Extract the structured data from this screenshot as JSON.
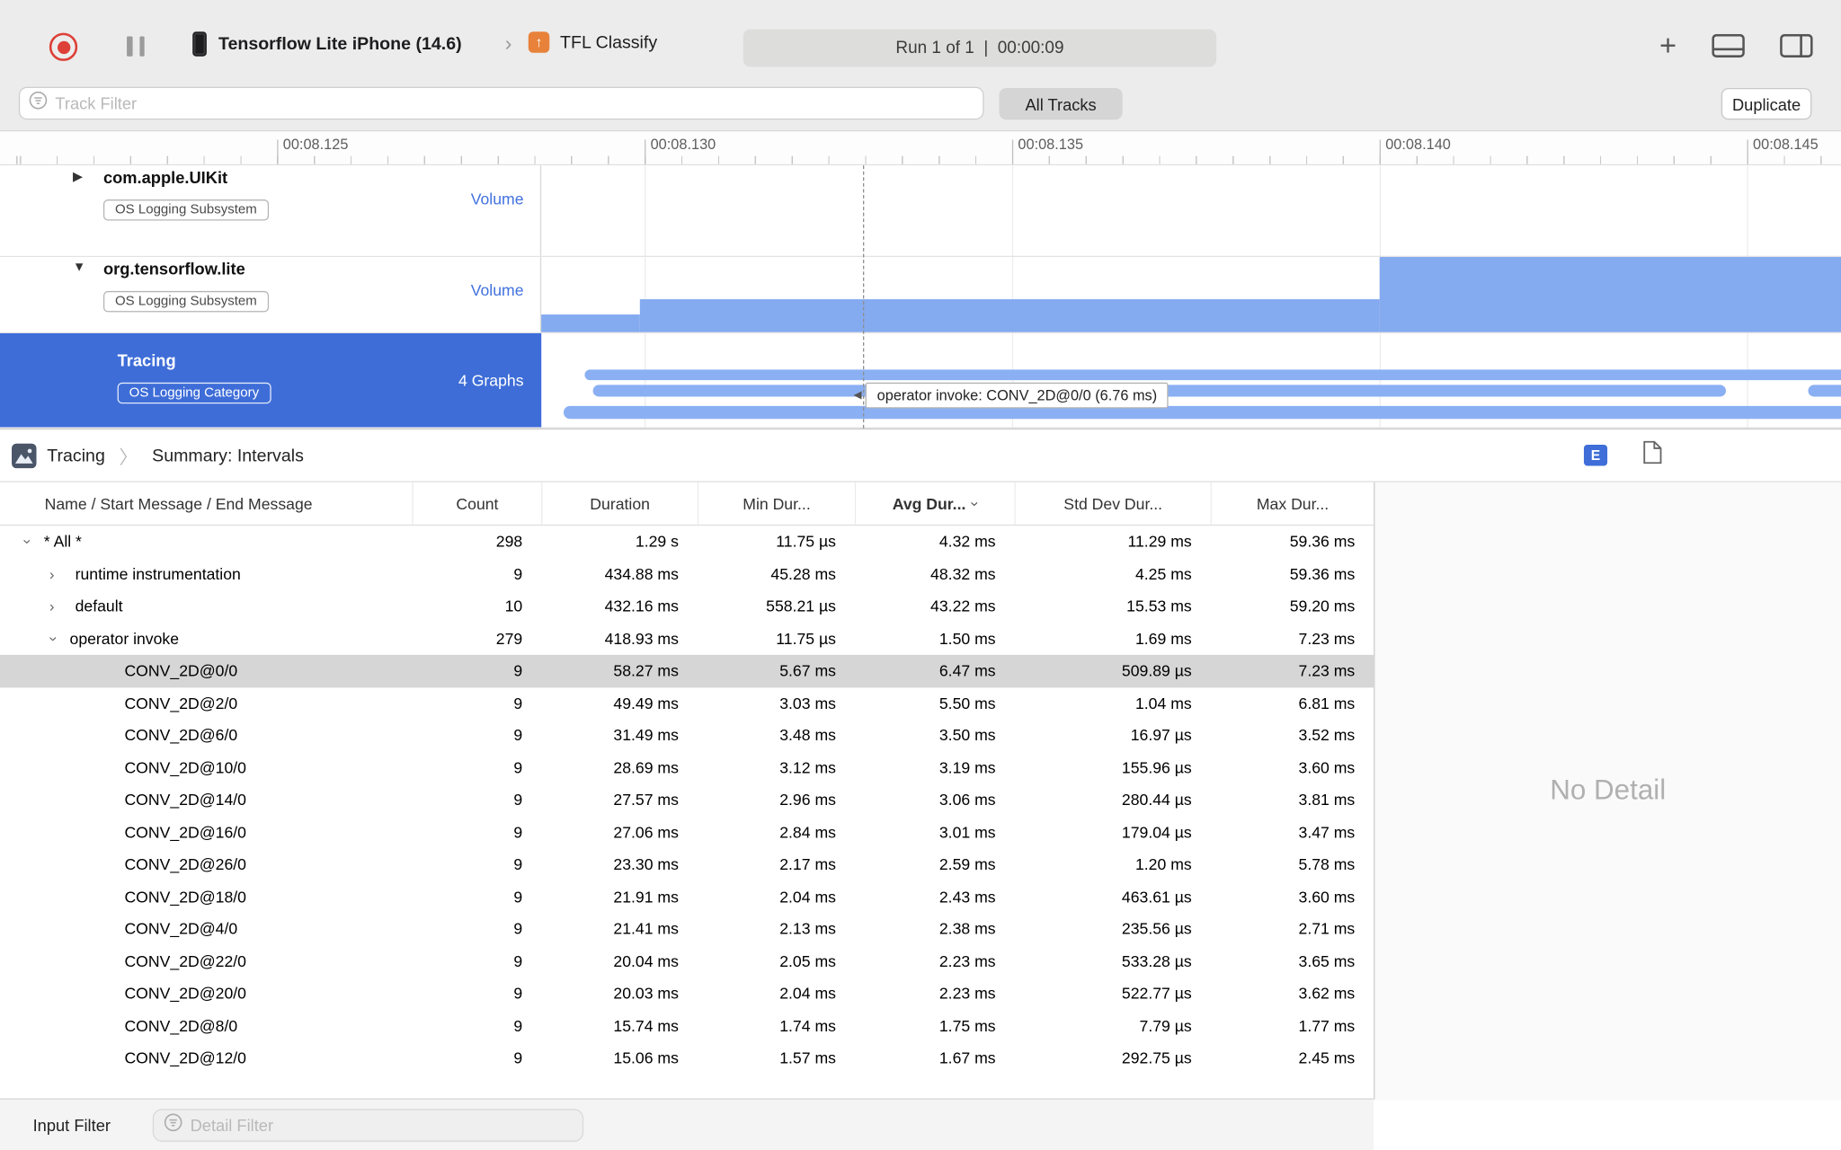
{
  "toolbar": {
    "device_name": "Tensorflow Lite iPhone (14.6)",
    "target_name": "TFL Classify",
    "run_status": "Run 1 of 1  |  00:00:09"
  },
  "filter_bar": {
    "track_filter_placeholder": "Track Filter",
    "all_tracks": "All Tracks",
    "duplicate": "Duplicate"
  },
  "ruler": {
    "labels": [
      "00:08.125",
      "00:08.130",
      "00:08.135",
      "00:08.140",
      "00:08.145"
    ]
  },
  "tracks": [
    {
      "name": "com.apple.UIKit",
      "badge": "OS Logging Subsystem",
      "meta": "Volume",
      "disclosure": "collapsed"
    },
    {
      "name": "org.tensorflow.lite",
      "badge": "OS Logging Subsystem",
      "meta": "Volume",
      "disclosure": "expanded"
    },
    {
      "name": "Tracing",
      "badge": "OS Logging Category",
      "meta": "4 Graphs",
      "selected": true
    }
  ],
  "timeline": {
    "tooltip": "operator invoke: CONV_2D@0/0 (6.76 ms)"
  },
  "breadcrumb": {
    "root": "Tracing",
    "page": "Summary: Intervals"
  },
  "detail_panel": {
    "empty_text": "No Detail",
    "jump_button": "E"
  },
  "bottom_bar": {
    "label": "Input Filter",
    "detail_filter_placeholder": "Detail Filter"
  },
  "table": {
    "columns": [
      "Name / Start Message / End Message",
      "Count",
      "Duration",
      "Min Dur...",
      "Avg Dur...",
      "Std Dev Dur...",
      "Max Dur..."
    ],
    "sorted_column": "Avg Dur...",
    "rows": [
      {
        "level": 0,
        "disclosure": "open",
        "name": "* All *",
        "count": "298",
        "duration": "1.29 s",
        "min": "11.75 µs",
        "avg": "4.32 ms",
        "std": "11.29 ms",
        "max": "59.36 ms",
        "selected": false
      },
      {
        "level": 1,
        "disclosure": "closed",
        "name": "runtime instrumentation",
        "count": "9",
        "duration": "434.88 ms",
        "min": "45.28 ms",
        "avg": "48.32 ms",
        "std": "4.25 ms",
        "max": "59.36 ms",
        "selected": false
      },
      {
        "level": 1,
        "disclosure": "closed",
        "name": "default",
        "count": "10",
        "duration": "432.16 ms",
        "min": "558.21 µs",
        "avg": "43.22 ms",
        "std": "15.53 ms",
        "max": "59.20 ms",
        "selected": false
      },
      {
        "level": 1,
        "disclosure": "open",
        "name": "operator invoke",
        "count": "279",
        "duration": "418.93 ms",
        "min": "11.75 µs",
        "avg": "1.50 ms",
        "std": "1.69 ms",
        "max": "7.23 ms",
        "selected": false
      },
      {
        "level": 2,
        "disclosure": null,
        "name": "CONV_2D@0/0",
        "count": "9",
        "duration": "58.27 ms",
        "min": "5.67 ms",
        "avg": "6.47 ms",
        "std": "509.89 µs",
        "max": "7.23 ms",
        "selected": true
      },
      {
        "level": 2,
        "disclosure": null,
        "name": "CONV_2D@2/0",
        "count": "9",
        "duration": "49.49 ms",
        "min": "3.03 ms",
        "avg": "5.50 ms",
        "std": "1.04 ms",
        "max": "6.81 ms",
        "selected": false
      },
      {
        "level": 2,
        "disclosure": null,
        "name": "CONV_2D@6/0",
        "count": "9",
        "duration": "31.49 ms",
        "min": "3.48 ms",
        "avg": "3.50 ms",
        "std": "16.97 µs",
        "max": "3.52 ms",
        "selected": false
      },
      {
        "level": 2,
        "disclosure": null,
        "name": "CONV_2D@10/0",
        "count": "9",
        "duration": "28.69 ms",
        "min": "3.12 ms",
        "avg": "3.19 ms",
        "std": "155.96 µs",
        "max": "3.60 ms",
        "selected": false
      },
      {
        "level": 2,
        "disclosure": null,
        "name": "CONV_2D@14/0",
        "count": "9",
        "duration": "27.57 ms",
        "min": "2.96 ms",
        "avg": "3.06 ms",
        "std": "280.44 µs",
        "max": "3.81 ms",
        "selected": false
      },
      {
        "level": 2,
        "disclosure": null,
        "name": "CONV_2D@16/0",
        "count": "9",
        "duration": "27.06 ms",
        "min": "2.84 ms",
        "avg": "3.01 ms",
        "std": "179.04 µs",
        "max": "3.47 ms",
        "selected": false
      },
      {
        "level": 2,
        "disclosure": null,
        "name": "CONV_2D@26/0",
        "count": "9",
        "duration": "23.30 ms",
        "min": "2.17 ms",
        "avg": "2.59 ms",
        "std": "1.20 ms",
        "max": "5.78 ms",
        "selected": false
      },
      {
        "level": 2,
        "disclosure": null,
        "name": "CONV_2D@18/0",
        "count": "9",
        "duration": "21.91 ms",
        "min": "2.04 ms",
        "avg": "2.43 ms",
        "std": "463.61 µs",
        "max": "3.60 ms",
        "selected": false
      },
      {
        "level": 2,
        "disclosure": null,
        "name": "CONV_2D@4/0",
        "count": "9",
        "duration": "21.41 ms",
        "min": "2.13 ms",
        "avg": "2.38 ms",
        "std": "235.56 µs",
        "max": "2.71 ms",
        "selected": false
      },
      {
        "level": 2,
        "disclosure": null,
        "name": "CONV_2D@22/0",
        "count": "9",
        "duration": "20.04 ms",
        "min": "2.05 ms",
        "avg": "2.23 ms",
        "std": "533.28 µs",
        "max": "3.65 ms",
        "selected": false
      },
      {
        "level": 2,
        "disclosure": null,
        "name": "CONV_2D@20/0",
        "count": "9",
        "duration": "20.03 ms",
        "min": "2.04 ms",
        "avg": "2.23 ms",
        "std": "522.77 µs",
        "max": "3.62 ms",
        "selected": false
      },
      {
        "level": 2,
        "disclosure": null,
        "name": "CONV_2D@8/0",
        "count": "9",
        "duration": "15.74 ms",
        "min": "1.74 ms",
        "avg": "1.75 ms",
        "std": "7.79 µs",
        "max": "1.77 ms",
        "selected": false
      },
      {
        "level": 2,
        "disclosure": null,
        "name": "CONV_2D@12/0",
        "count": "9",
        "duration": "15.06 ms",
        "min": "1.57 ms",
        "avg": "1.67 ms",
        "std": "292.75 µs",
        "max": "2.45 ms",
        "selected": false
      }
    ]
  },
  "colors": {
    "accent_blue": "#3e6dd8",
    "bar_blue": "#84aaf0",
    "record_red": "#dd4038"
  }
}
